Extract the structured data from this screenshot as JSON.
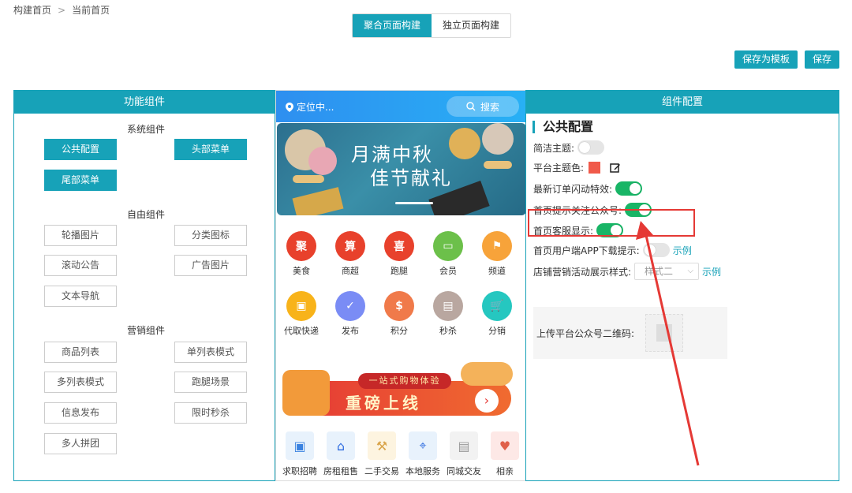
{
  "breadcrumb": {
    "items": [
      "构建首页",
      "当前首页"
    ],
    "separator": ">"
  },
  "mode_tabs": [
    {
      "label": "聚合页面构建",
      "active": true
    },
    {
      "label": "独立页面构建",
      "active": false
    }
  ],
  "actions": {
    "save_template": "保存为模板",
    "save": "保存"
  },
  "left_panel": {
    "title": "功能组件",
    "system": {
      "title": "系统组件",
      "items": [
        "公共配置",
        "头部菜单",
        "尾部菜单"
      ]
    },
    "free": {
      "title": "自由组件",
      "items": [
        "轮播图片",
        "分类图标",
        "滚动公告",
        "广告图片",
        "文本导航"
      ]
    },
    "marketing": {
      "title": "营销组件",
      "items": [
        "商品列表",
        "单列表模式",
        "多列表模式",
        "跑腿场景",
        "信息发布",
        "限时秒杀",
        "多人拼团"
      ]
    }
  },
  "preview": {
    "location": "定位中...",
    "search": "搜索",
    "banner_text_1": "月满中秋",
    "banner_text_2": "佳节献礼",
    "icons_row1": [
      {
        "label": "美食",
        "glyph": "聚",
        "color": "#e8412c"
      },
      {
        "label": "商超",
        "glyph": "算",
        "color": "#e8412c"
      },
      {
        "label": "跑腿",
        "glyph": "喜",
        "color": "#e8412c"
      },
      {
        "label": "会员",
        "glyph": "▭",
        "color": "#6cc04a"
      },
      {
        "label": "频道",
        "glyph": "⚑",
        "color": "#f7a33a"
      }
    ],
    "icons_row2": [
      {
        "label": "代取快递",
        "glyph": "▣",
        "color": "#f8b31a"
      },
      {
        "label": "发布",
        "glyph": "✓",
        "color": "#7a8cf5"
      },
      {
        "label": "积分",
        "glyph": "$",
        "color": "#f07a4a"
      },
      {
        "label": "秒杀",
        "glyph": "▤",
        "color": "#b9a7a0"
      },
      {
        "label": "分销",
        "glyph": "🛒",
        "color": "#25c7c0"
      }
    ],
    "promo_top": "一站式购物体验",
    "promo_main": "重磅上线",
    "strip": [
      "求职招聘",
      "房租租售",
      "二手交易",
      "本地服务",
      "同城交友",
      "相亲"
    ]
  },
  "config": {
    "panel_title": "组件配置",
    "section_title": "公共配置",
    "simple_theme": {
      "label": "简洁主题:",
      "on": false
    },
    "theme_color": {
      "label": "平台主题色:",
      "color": "#f05a4a"
    },
    "order_flash": {
      "label": "最新订单闪动特效:",
      "on": true
    },
    "follow_tip": {
      "label": "首页提示关注公众号:",
      "on": true
    },
    "service_show": {
      "label": "首页客服显示:",
      "on": true
    },
    "app_download": {
      "label": "首页用户端APP下载提示:",
      "on": false,
      "example": "示例"
    },
    "marketing_style": {
      "label": "店铺营销活动展示样式:",
      "value": "样式二",
      "example": "示例"
    },
    "upload_qr": {
      "label": "上传平台公众号二维码:"
    }
  },
  "colors": {
    "accent": "#17a2b8",
    "toggle_on": "#18b566",
    "annotation": "#e53935"
  }
}
